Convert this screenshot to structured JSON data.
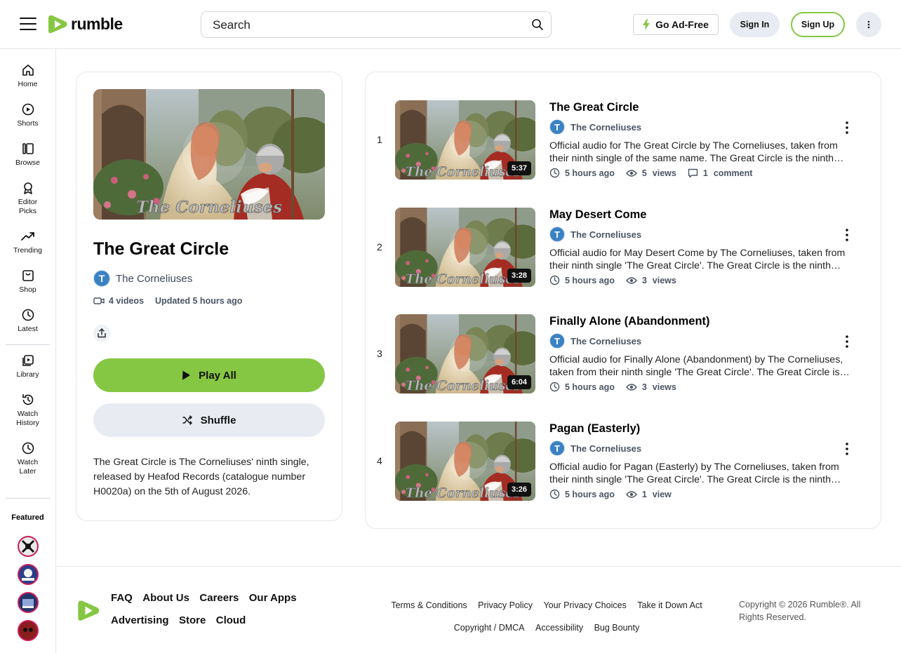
{
  "header": {
    "logo_text": "rumble",
    "search_placeholder": "Search",
    "adfree_label": "Go Ad-Free",
    "signin_label": "Sign In",
    "signup_label": "Sign Up"
  },
  "sidebar": {
    "items": [
      {
        "label": "Home",
        "icon": "home-icon"
      },
      {
        "label": "Shorts",
        "icon": "shorts-icon"
      },
      {
        "label": "Browse",
        "icon": "browse-icon"
      },
      {
        "label": "Editor Picks",
        "icon": "ribbon-icon"
      },
      {
        "label": "Trending",
        "icon": "trending-icon"
      },
      {
        "label": "Shop",
        "icon": "shop-icon"
      },
      {
        "label": "Latest",
        "icon": "clock-icon"
      },
      {
        "label": "Library",
        "icon": "library-icon"
      },
      {
        "label": "Watch History",
        "icon": "history-icon"
      },
      {
        "label": "Watch Later",
        "icon": "clock-icon"
      }
    ],
    "featured_label": "Featured"
  },
  "playlist": {
    "thumb_caption": "The Corneliuses",
    "title": "The Great Circle",
    "channel_initial": "T",
    "channel": "The Corneliuses",
    "video_count": "4 videos",
    "updated": "Updated 5 hours ago",
    "play_all_label": "Play All",
    "shuffle_label": "Shuffle",
    "description": "The Great Circle is The Corneliuses' ninth single, released by Heafod Records (catalogue number H0020a) on the 5th of August 2026."
  },
  "videos": [
    {
      "num": "1",
      "title": "The Great Circle",
      "channel": "The Corneliuses",
      "initial": "T",
      "duration": "5:37",
      "description": "Official audio for The Great Circle by The Corneliuses, taken from their ninth single of the same name. The Great Circle is the ninth single by The Corneliuses.",
      "time": "5 hours ago",
      "views_num": "5",
      "views_label": "views",
      "comments_num": "1",
      "comments_label": "comment"
    },
    {
      "num": "2",
      "title": "May Desert Come",
      "channel": "The Corneliuses",
      "initial": "T",
      "duration": "3:28",
      "description": "Official audio for May Desert Come by The Corneliuses, taken from their ninth single 'The Great Circle'. The Great Circle is the ninth single.",
      "time": "5 hours ago",
      "views_num": "3",
      "views_label": "views"
    },
    {
      "num": "3",
      "title": "Finally Alone (Abandonment)",
      "channel": "The Corneliuses",
      "initial": "T",
      "duration": "6:04",
      "description": "Official audio for Finally Alone (Abandonment) by The Corneliuses, taken from their ninth single 'The Great Circle'. The Great Circle is the ninth single.",
      "time": "5 hours ago",
      "views_num": "3",
      "views_label": "views"
    },
    {
      "num": "4",
      "title": "Pagan (Easterly)",
      "channel": "The Corneliuses",
      "initial": "T",
      "duration": "3:26",
      "description": "Official audio for Pagan (Easterly) by The Corneliuses, taken from their ninth single 'The Great Circle'. The Great Circle is the ninth single.",
      "time": "5 hours ago",
      "views_num": "1",
      "views_label": "view"
    }
  ],
  "footer": {
    "main_links": [
      "FAQ",
      "About Us",
      "Careers",
      "Our Apps",
      "Advertising",
      "Store",
      "Cloud"
    ],
    "legal_links": [
      "Terms & Conditions",
      "Privacy Policy",
      "Your Privacy Choices",
      "Take it Down Act",
      "Copyright / DMCA",
      "Accessibility",
      "Bug Bounty"
    ],
    "copyright": "Copyright © 2026 Rumble®. All Rights Reserved."
  },
  "colors": {
    "brand_green": "#85c742",
    "avatar_blue": "#3b82c4",
    "featured_ring": "#d11e5c"
  }
}
